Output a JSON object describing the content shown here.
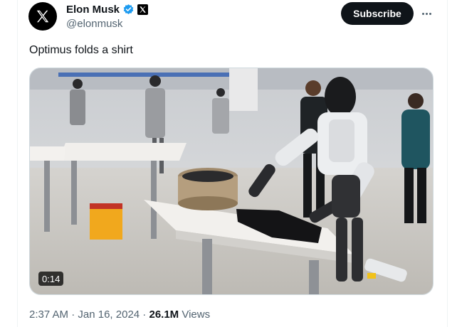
{
  "author": {
    "display_name": "Elon Musk",
    "handle": "@elonmusk",
    "verified_icon": "verified-badge-icon",
    "affiliation_icon": "x-logo-icon"
  },
  "actions": {
    "subscribe_label": "Subscribe"
  },
  "tweet": {
    "text": "Optimus folds a shirt"
  },
  "media": {
    "duration": "0:14"
  },
  "meta": {
    "time": "2:37 AM",
    "separator1": " · ",
    "date": "Jan 16, 2024",
    "separator2": " · ",
    "views_count": "26.1M",
    "views_label": " Views"
  },
  "colors": {
    "text_primary": "#0f1419",
    "text_secondary": "#536471",
    "verified_blue": "#1d9bf0",
    "border": "#cfd9de"
  }
}
